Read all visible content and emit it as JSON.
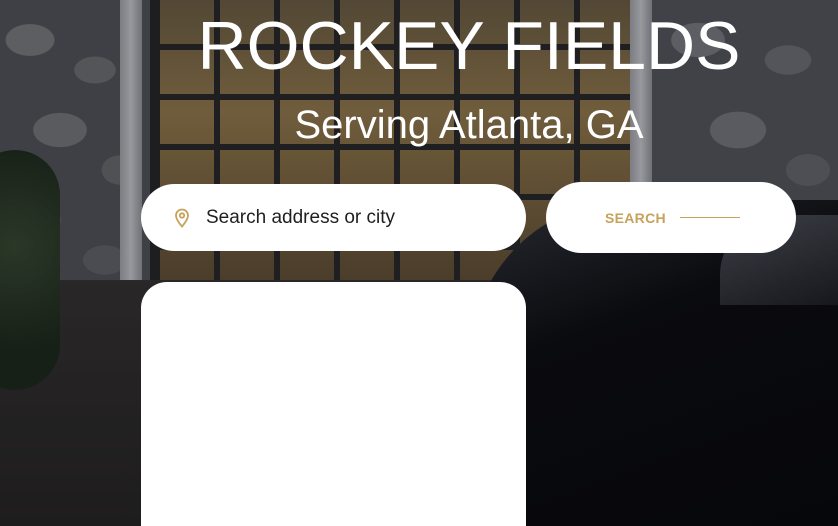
{
  "hero": {
    "title": "ROCKEY FIELDS",
    "subtitle": "Serving Atlanta, GA"
  },
  "search": {
    "placeholder": "Search address or city",
    "value": "",
    "icon": "location-pin-icon",
    "button_label": "SEARCH"
  },
  "colors": {
    "accent": "#c6a25a",
    "text_on_hero": "#ffffff",
    "field_bg": "#ffffff"
  }
}
